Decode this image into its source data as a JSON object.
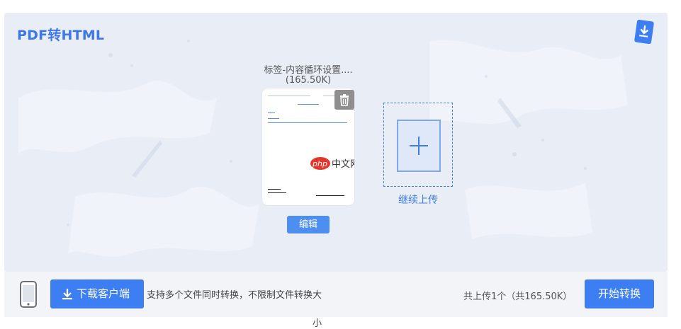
{
  "app": {
    "title": "PDF转HTML"
  },
  "file": {
    "name": "标签-内容循环设置....",
    "size": "(165.50K)",
    "delete_icon": "trash-icon",
    "watermark": "php中文网"
  },
  "actions": {
    "edit_label": "编辑",
    "continue_upload_label": "继续上传"
  },
  "bottom": {
    "download_client_label": "下载客户端",
    "support_text": "支持多个文件同时转换，不限制文件转换大",
    "support_text_overflow": "小",
    "upload_count": "共上传1个（共165.50K）",
    "start_label": "开始转换"
  },
  "colors": {
    "accent": "#3d7ff2",
    "title": "#3d78e6",
    "panel_bg": "#e8edf6",
    "bottom_bg": "#f2f4f8"
  },
  "icons": {
    "top_right": "download-app-icon",
    "phone": "mobile-phone-icon",
    "download": "download-arrow-icon",
    "add": "plus-icon"
  }
}
